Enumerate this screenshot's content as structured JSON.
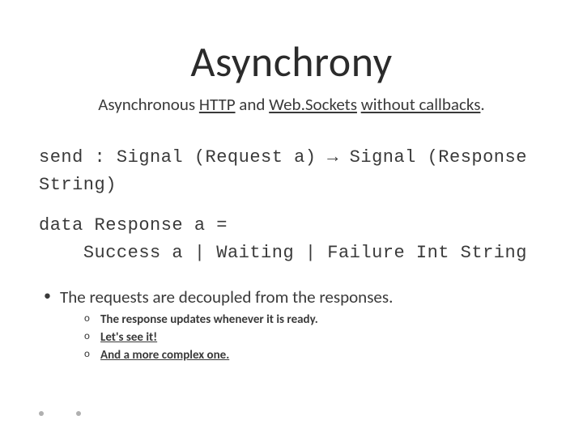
{
  "title": "Asynchrony",
  "subtitle": {
    "t1": "Asynchronous ",
    "u1": "HTTP",
    "t2": " and ",
    "u2": "Web.Sockets",
    "t3": " ",
    "u3": "without callbacks",
    "t4": "."
  },
  "code1": {
    "a": "send : Signal (Request a) ",
    "arrow": "→",
    "b": " Signal (Response String)"
  },
  "code2": {
    "a": "data Response a =\n    Success a | Waiting | Failure Int String"
  },
  "bullet_main": "The requests are decoupled from the responses.",
  "sub1": "The response updates whenever it is ready.",
  "sub2": "Let's see it!",
  "sub3": "And a more complex one."
}
